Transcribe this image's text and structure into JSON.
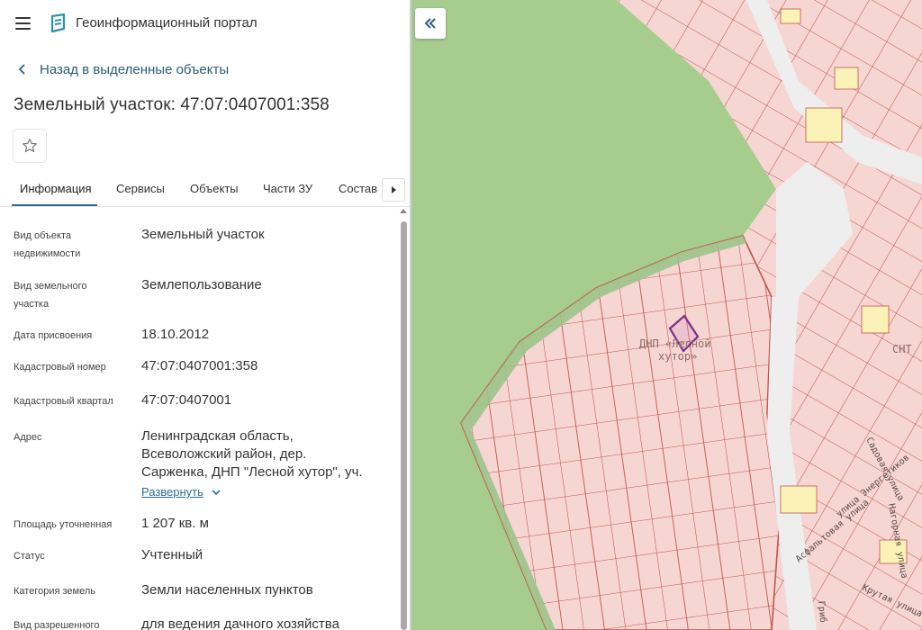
{
  "header": {
    "app_title": "Геоинформационный портал",
    "menu_icon": "hamburger-icon",
    "logo_icon": "portal-logo-icon"
  },
  "back_link": {
    "label": "Назад в выделенные объекты"
  },
  "page_title": "Земельный участок: 47:07:0407001:358",
  "favorite": {
    "icon": "star-icon"
  },
  "tabs": [
    {
      "label": "Информация",
      "active": true
    },
    {
      "label": "Сервисы"
    },
    {
      "label": "Объекты"
    },
    {
      "label": "Части ЗУ"
    },
    {
      "label": "Состав"
    }
  ],
  "info": {
    "object_type": {
      "label_line1": "Вид объекта",
      "label_line2": "недвижимости",
      "value": "Земельный участок"
    },
    "parcel_type": {
      "label_line1": "Вид земельного",
      "label_line2": "участка",
      "value": "Землепользование"
    },
    "assign_date": {
      "label": "Дата присвоения",
      "value": "18.10.2012"
    },
    "cadastral_number": {
      "label": "Кадастровый номер",
      "value": "47:07:0407001:358"
    },
    "cadastral_block": {
      "label": "Кадастровый квартал",
      "value": "47:07:0407001"
    },
    "address": {
      "label": "Адрес",
      "line1": "Ленинградская область,",
      "line2": "Всеволожский район, дер.",
      "line3": "Сарженка, ДНП \"Лесной хутор\", уч.",
      "expand_label": "Развернуть"
    },
    "area": {
      "label": "Площадь уточненная",
      "value": "1 207 кв. м"
    },
    "status": {
      "label": "Статус",
      "value": "Учтенный"
    },
    "land_category": {
      "label": "Категория земель",
      "value": "Земли населенных пунктов"
    },
    "permitted_use": {
      "label": "Вид разрешенного",
      "value": "для ведения дачного хозяйства"
    }
  },
  "map": {
    "labels": {
      "dnp_line1": "ДНП «Лесной",
      "dnp_line2": "хутор»",
      "snt": "СНТ",
      "street_sadovaya": "Садовая улица",
      "street_energetikov": "улица Энергетиков",
      "street_nagornaya": "Нагорная улица",
      "street_asfaltovaya": "Асфальтовая улица",
      "street_krutaya": "Крутая улица",
      "street_grib": "Гриб"
    },
    "colors": {
      "forest": "#a6cd8e",
      "parcel_fill": "#f6d6d3",
      "parcel_border": "#c25449",
      "selected_border": "#7a2f83",
      "road": "#eeeeee",
      "yellow_parcel": "#fbf2b7"
    }
  }
}
